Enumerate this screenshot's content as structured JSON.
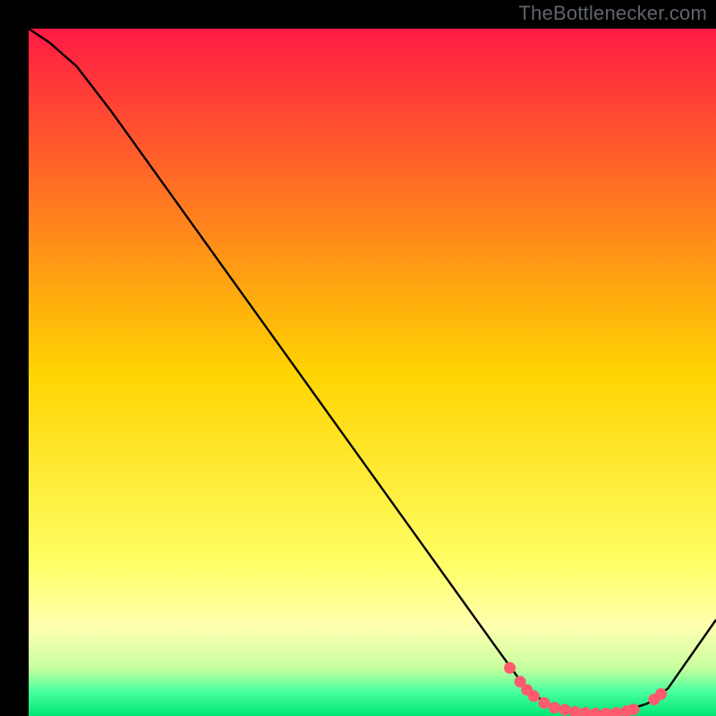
{
  "watermark": "TheBottlenecker.com",
  "chart_data": {
    "type": "line",
    "title": "",
    "xlabel": "",
    "ylabel": "",
    "xlim": [
      0,
      100
    ],
    "ylim": [
      0,
      100
    ],
    "background_gradient": {
      "stops": [
        {
          "at": 0.0,
          "color": "#ff1a44"
        },
        {
          "at": 0.5,
          "color": "#ffd400"
        },
        {
          "at": 0.78,
          "color": "#ffff66"
        },
        {
          "at": 0.87,
          "color": "#ffffb0"
        },
        {
          "at": 0.93,
          "color": "#c8ff9e"
        },
        {
          "at": 0.965,
          "color": "#48ff9e"
        },
        {
          "at": 1.0,
          "color": "#00e676"
        }
      ]
    },
    "curve": [
      {
        "x": 0.0,
        "y": 100.0
      },
      {
        "x": 3.0,
        "y": 98.0
      },
      {
        "x": 7.0,
        "y": 94.5
      },
      {
        "x": 12.0,
        "y": 88.0
      },
      {
        "x": 68.0,
        "y": 10.0
      },
      {
        "x": 72.0,
        "y": 4.5
      },
      {
        "x": 75.0,
        "y": 2.0
      },
      {
        "x": 78.0,
        "y": 0.8
      },
      {
        "x": 82.0,
        "y": 0.3
      },
      {
        "x": 86.0,
        "y": 0.5
      },
      {
        "x": 90.0,
        "y": 1.8
      },
      {
        "x": 93.0,
        "y": 4.0
      },
      {
        "x": 100.0,
        "y": 14.0
      }
    ],
    "dots": [
      {
        "x": 70.0,
        "y": 7.0
      },
      {
        "x": 71.5,
        "y": 5.0
      },
      {
        "x": 72.5,
        "y": 3.8
      },
      {
        "x": 73.5,
        "y": 2.9
      },
      {
        "x": 75.0,
        "y": 1.9
      },
      {
        "x": 76.5,
        "y": 1.2
      },
      {
        "x": 78.0,
        "y": 0.9
      },
      {
        "x": 79.5,
        "y": 0.6
      },
      {
        "x": 81.0,
        "y": 0.45
      },
      {
        "x": 82.5,
        "y": 0.35
      },
      {
        "x": 84.0,
        "y": 0.35
      },
      {
        "x": 85.5,
        "y": 0.45
      },
      {
        "x": 87.0,
        "y": 0.7
      },
      {
        "x": 88.0,
        "y": 0.95
      },
      {
        "x": 91.0,
        "y": 2.4
      },
      {
        "x": 92.0,
        "y": 3.2
      }
    ],
    "dot_color": "#ff5a6e",
    "curve_color": "#000000"
  }
}
